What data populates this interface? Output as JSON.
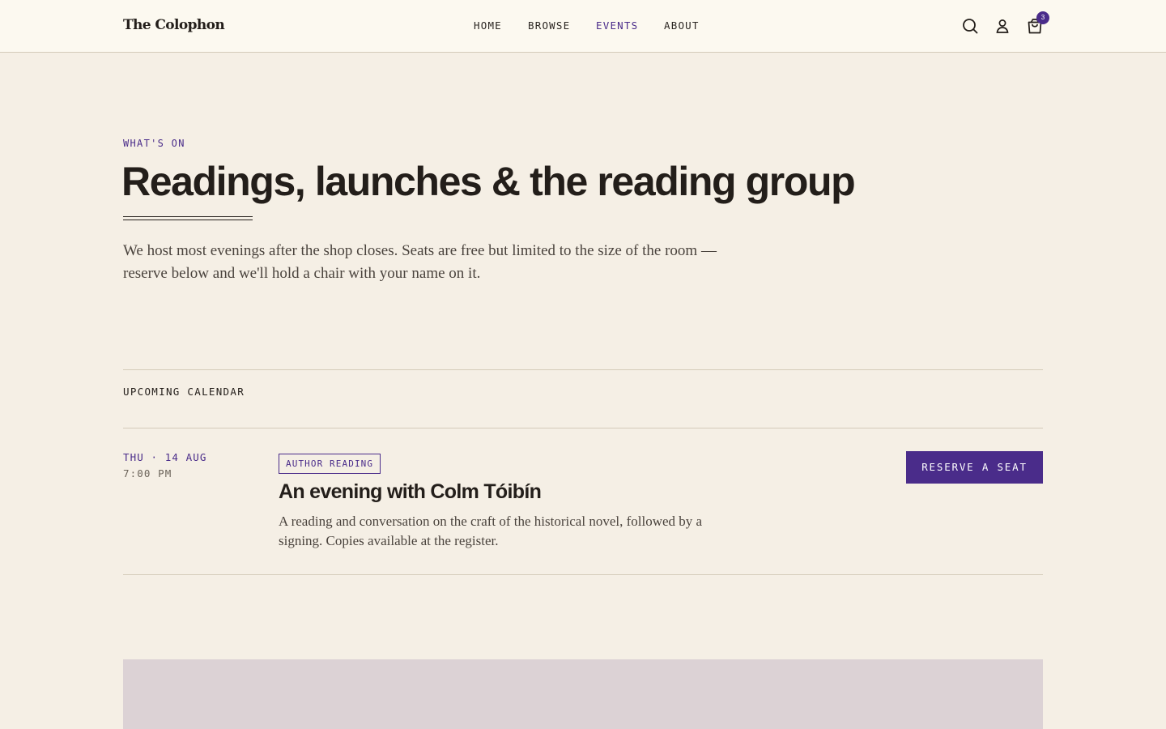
{
  "header": {
    "logo": "The Colophon",
    "nav": [
      {
        "label": "HOME",
        "active": false
      },
      {
        "label": "BROWSE",
        "active": false
      },
      {
        "label": "EVENTS",
        "active": true
      },
      {
        "label": "ABOUT",
        "active": false
      }
    ],
    "icons": [
      "search-icon",
      "account-icon",
      "cart-icon"
    ],
    "cart_count": "3"
  },
  "hero": {
    "eyebrow": "WHAT'S ON",
    "title": "Readings, launches & the reading group",
    "intro": "We host most evenings after the shop closes. Seats are free but limited to the size of the room — reserve below and we'll hold a chair with your name on it."
  },
  "calendar": {
    "label": "UPCOMING CALENDAR",
    "events": [
      {
        "date": "THU · 14 AUG",
        "time": "7:00 PM",
        "tag": "AUTHOR READING",
        "title": "An evening with Colm Tóibín",
        "description": "A reading and conversation on the craft of the historical novel, followed by a signing. Copies available at the register.",
        "cta": "RESERVE A SEAT"
      }
    ]
  },
  "colors": {
    "accent": "#4a2c8a",
    "background": "#f5efe5",
    "header_background": "#fcf9f0",
    "text": "#231e1a",
    "rule": "#d4cbb9",
    "image_placeholder": "#dcd2d5"
  }
}
